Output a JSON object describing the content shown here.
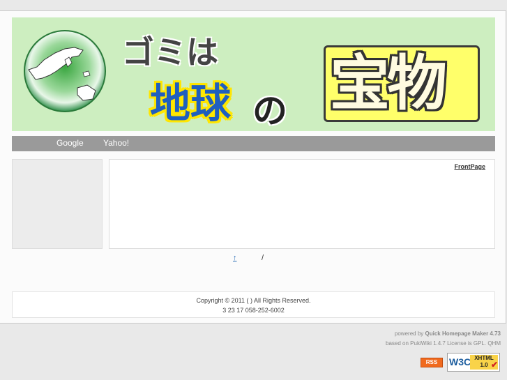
{
  "header": {
    "gomi_text": "ゴミは",
    "chikyu_text": "地球",
    "no_text": "の",
    "takara_text": "宝物",
    "globe_icon": "earth-globe-icon"
  },
  "nav": {
    "items": [
      {
        "label": "Google"
      },
      {
        "label": "Yahoo!"
      }
    ]
  },
  "content": {
    "page_name": "FrontPage"
  },
  "toplinks": {
    "up_arrow": "↑",
    "slash": "/"
  },
  "footer": {
    "copyright": "Copyright © 2011 ( )     All Rights Reserved.",
    "address": "3  23 17  058-252-6002"
  },
  "powered": {
    "line1_prefix": "powered by ",
    "line1_app": "Quick Homepage Maker 4.73",
    "line2": "based on PukiWiki 1.4.7  License is GPL. QHM"
  },
  "badges": {
    "rss_label": "RSS",
    "w3c_label": "W3C",
    "xhtml_label": "XHTML",
    "xhtml_version": "1.0",
    "check": "✔"
  },
  "colors": {
    "header_bg": "#cdeec0",
    "nav_bg": "#9a9a9a",
    "chikyu_text": "#1f5fbf",
    "chikyu_outline": "#ffe600",
    "takara_bg": "#ffff6a",
    "rss_orange": "#f06a1e"
  }
}
